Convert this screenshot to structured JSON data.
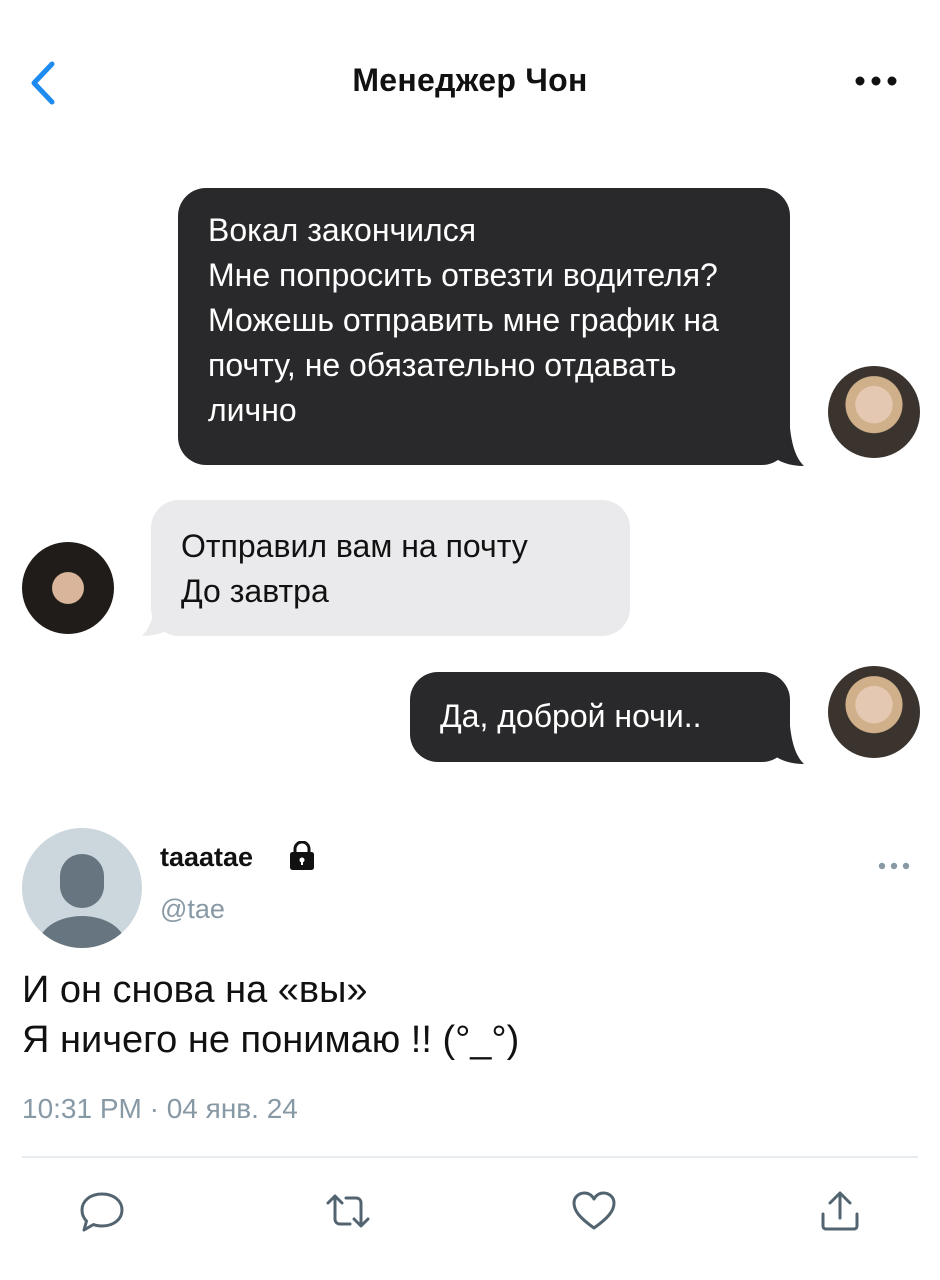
{
  "chat": {
    "title": "Менеджер Чон",
    "icons": {
      "back": "chevron-left-icon",
      "more": "more-horizontal-icon"
    },
    "messages": [
      {
        "direction": "outgoing",
        "text": "Вокал закончился\nМне попросить отвезти водителя? Можешь отправить мне график на почту, не обязательно отдавать лично"
      },
      {
        "direction": "incoming",
        "text": "Отправил вам на почту\nДо завтра"
      },
      {
        "direction": "outgoing",
        "text": "Да, доброй ночи.."
      }
    ]
  },
  "tweet": {
    "display_name": "taaatae",
    "handle": "@tae",
    "text": "И он снова на «вы»\nЯ ничего не понимаю !! (°_°)",
    "timestamp": "10:31 PM · 04 янв. 24",
    "actions": [
      "reply-icon",
      "retweet-icon",
      "like-icon",
      "share-icon"
    ]
  },
  "colors": {
    "accent": "#1d8bf0",
    "outgoing_bubble": "#29292b",
    "incoming_bubble": "#eaeaec",
    "muted_text": "#8899a6",
    "divider": "#e6ecf0"
  }
}
